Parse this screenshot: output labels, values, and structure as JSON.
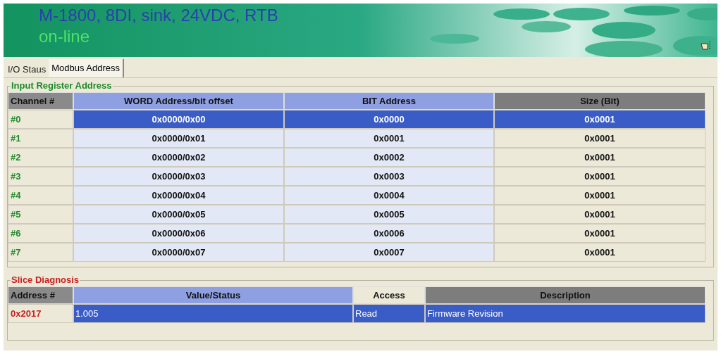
{
  "header": {
    "title": "M-1800, 8DI, sink, 24VDC, RTB",
    "status": "on-line"
  },
  "tabs": [
    {
      "label": "I/O Staus",
      "selected": false
    },
    {
      "label": "Modbus Address",
      "selected": true
    }
  ],
  "input_register": {
    "title": "Input Register Address",
    "columns": [
      "Channel #",
      "WORD Address/bit offset",
      "BIT Address",
      "Size (Bit)"
    ],
    "rows": [
      {
        "cells": [
          "#0",
          "0x0000/0x00",
          "0x0000",
          "0x0001"
        ],
        "selected": true
      },
      {
        "cells": [
          "#1",
          "0x0000/0x01",
          "0x0001",
          "0x0001"
        ],
        "selected": false
      },
      {
        "cells": [
          "#2",
          "0x0000/0x02",
          "0x0002",
          "0x0001"
        ],
        "selected": false
      },
      {
        "cells": [
          "#3",
          "0x0000/0x03",
          "0x0003",
          "0x0001"
        ],
        "selected": false
      },
      {
        "cells": [
          "#4",
          "0x0000/0x04",
          "0x0004",
          "0x0001"
        ],
        "selected": false
      },
      {
        "cells": [
          "#5",
          "0x0000/0x05",
          "0x0005",
          "0x0001"
        ],
        "selected": false
      },
      {
        "cells": [
          "#6",
          "0x0000/0x06",
          "0x0006",
          "0x0001"
        ],
        "selected": false
      },
      {
        "cells": [
          "#7",
          "0x0000/0x07",
          "0x0007",
          "0x0001"
        ],
        "selected": false
      }
    ]
  },
  "slice_diagnosis": {
    "title": "Slice Diagnosis",
    "columns": [
      "Address #",
      "Value/Status",
      "Access",
      "Description"
    ],
    "rows": [
      {
        "cells": [
          "0x2017",
          "1.005",
          "Read",
          "Firmware Revision"
        ],
        "selected": true
      }
    ]
  }
}
